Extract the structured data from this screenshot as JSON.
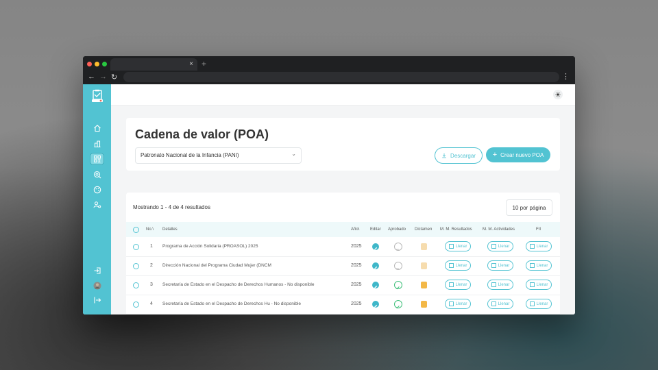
{
  "colors": {
    "accent": "#52c3d2",
    "sidebar": "#52c3d2",
    "chrome": "#1f2022"
  },
  "browser": {
    "tab_close": "×",
    "new_tab": "+",
    "back": "←",
    "forward": "→",
    "reload": "↻",
    "menu": "⋮"
  },
  "sidebar": {
    "items": [
      {
        "name": "home-icon",
        "active": false
      },
      {
        "name": "buildings-icon",
        "active": false
      },
      {
        "name": "qr-grid-icon",
        "active": true
      },
      {
        "name": "target-search-icon",
        "active": false
      },
      {
        "name": "palette-icon",
        "active": false
      },
      {
        "name": "users-gear-icon",
        "active": false
      }
    ],
    "bottom": [
      "login-icon",
      "avatar",
      "logout-icon"
    ]
  },
  "header": {
    "title": "Cadena de valor (POA)"
  },
  "filter": {
    "selected": "Patronato Nacional de la Infancia (PANI)"
  },
  "buttons": {
    "download": "Descargar",
    "create": "Crear nuevo POA"
  },
  "table": {
    "showing": "Mostrando 1 - 4 de 4 resultados",
    "per_page": "10 por página",
    "columns": [
      "No.\\",
      "Detalles",
      "Año\\",
      "Editar",
      "Aprobado",
      "Dictamen",
      "M. M. Resultados",
      "M. M. Actividades",
      "FII"
    ],
    "fill_label": "Llenar",
    "rows": [
      {
        "no": "1",
        "detalle": "Programa de Acción Solidaria (PROASOL) 2025",
        "anio": "2025",
        "aprobado": "pending",
        "dictamen": "light"
      },
      {
        "no": "2",
        "detalle": "Dirección Nacional del Programa Ciudad Mujer (DNCM",
        "anio": "2025",
        "aprobado": "pending",
        "dictamen": "light"
      },
      {
        "no": "3",
        "detalle": "Secretaría de Estado en el Despacho de Derechos Humanos - No disponible",
        "anio": "2025",
        "aprobado": "ok",
        "dictamen": "full"
      },
      {
        "no": "4",
        "detalle": "Secretaría de Estado en el Despacho de Derechos Hu - No disponible",
        "anio": "2025",
        "aprobado": "ok",
        "dictamen": "full"
      }
    ]
  }
}
